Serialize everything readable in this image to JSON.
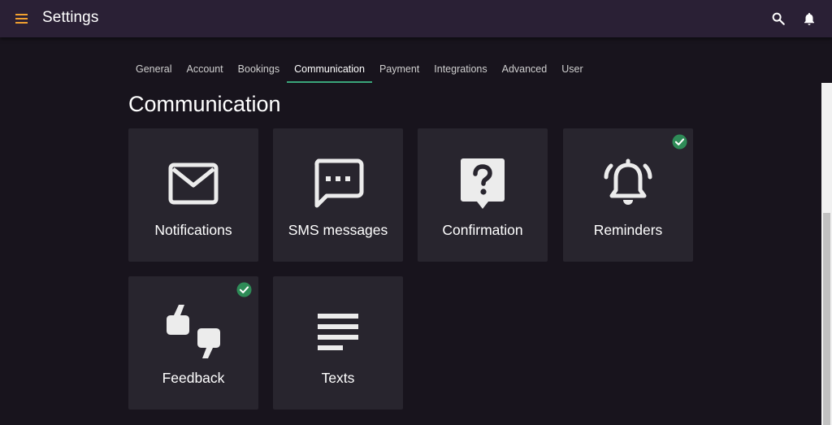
{
  "appbar": {
    "title": "Settings",
    "menu_icon": "menu-icon",
    "search_icon": "search-icon",
    "notifications_icon": "bell-icon"
  },
  "tabs": [
    {
      "label": "General",
      "active": false
    },
    {
      "label": "Account",
      "active": false
    },
    {
      "label": "Bookings",
      "active": false
    },
    {
      "label": "Communication",
      "active": true
    },
    {
      "label": "Payment",
      "active": false
    },
    {
      "label": "Integrations",
      "active": false
    },
    {
      "label": "Advanced",
      "active": false
    },
    {
      "label": "User",
      "active": false
    }
  ],
  "section": {
    "title": "Communication"
  },
  "cards": [
    {
      "label": "Notifications",
      "icon": "envelope-icon",
      "enabled": false
    },
    {
      "label": "SMS messages",
      "icon": "sms-icon",
      "enabled": false
    },
    {
      "label": "Confirmation",
      "icon": "question-icon",
      "enabled": false
    },
    {
      "label": "Reminders",
      "icon": "alarm-bell-icon",
      "enabled": true
    },
    {
      "label": "Feedback",
      "icon": "quote-icon",
      "enabled": true
    },
    {
      "label": "Texts",
      "icon": "text-lines-icon",
      "enabled": false
    }
  ],
  "colors": {
    "appbar": "#2a2035",
    "background": "#18141d",
    "card": "#28252e",
    "accent_menu": "#f0a030",
    "active_tab_underline": "#3aa67a",
    "check": "#2e8b57"
  }
}
